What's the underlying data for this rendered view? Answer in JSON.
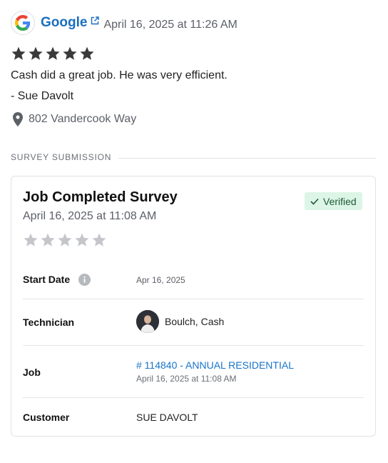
{
  "review": {
    "source": "Google",
    "timestamp": "April 16, 2025 at 11:26 AM",
    "rating": 5,
    "text": "Cash did a great job. He was very efficient.",
    "author": "- Sue Davolt",
    "address": "802 Vandercook Way"
  },
  "section": {
    "label": "SURVEY SUBMISSION"
  },
  "survey": {
    "title": "Job Completed Survey",
    "timestamp": "April 16, 2025 at 11:08 AM",
    "badge": "Verified",
    "rating": 0,
    "fields": {
      "start_date": {
        "label": "Start Date",
        "value": "Apr 16, 2025"
      },
      "technician": {
        "label": "Technician",
        "value": "Boulch, Cash"
      },
      "job": {
        "label": "Job",
        "link": "# 114840 - ANNUAL RESIDENTIAL",
        "sub": "April 16, 2025 at 11:08 AM"
      },
      "customer": {
        "label": "Customer",
        "value": "SUE DAVOLT"
      }
    }
  },
  "colors": {
    "link": "#1a6fbf",
    "star_filled": "#3a3a3a",
    "star_empty": "#c4c6ca",
    "badge_bg": "#dcf5e6",
    "badge_text": "#1f5a37"
  },
  "icons": [
    "google-logo",
    "external-link-icon",
    "star-icon",
    "map-pin-icon",
    "check-icon",
    "info-icon"
  ]
}
